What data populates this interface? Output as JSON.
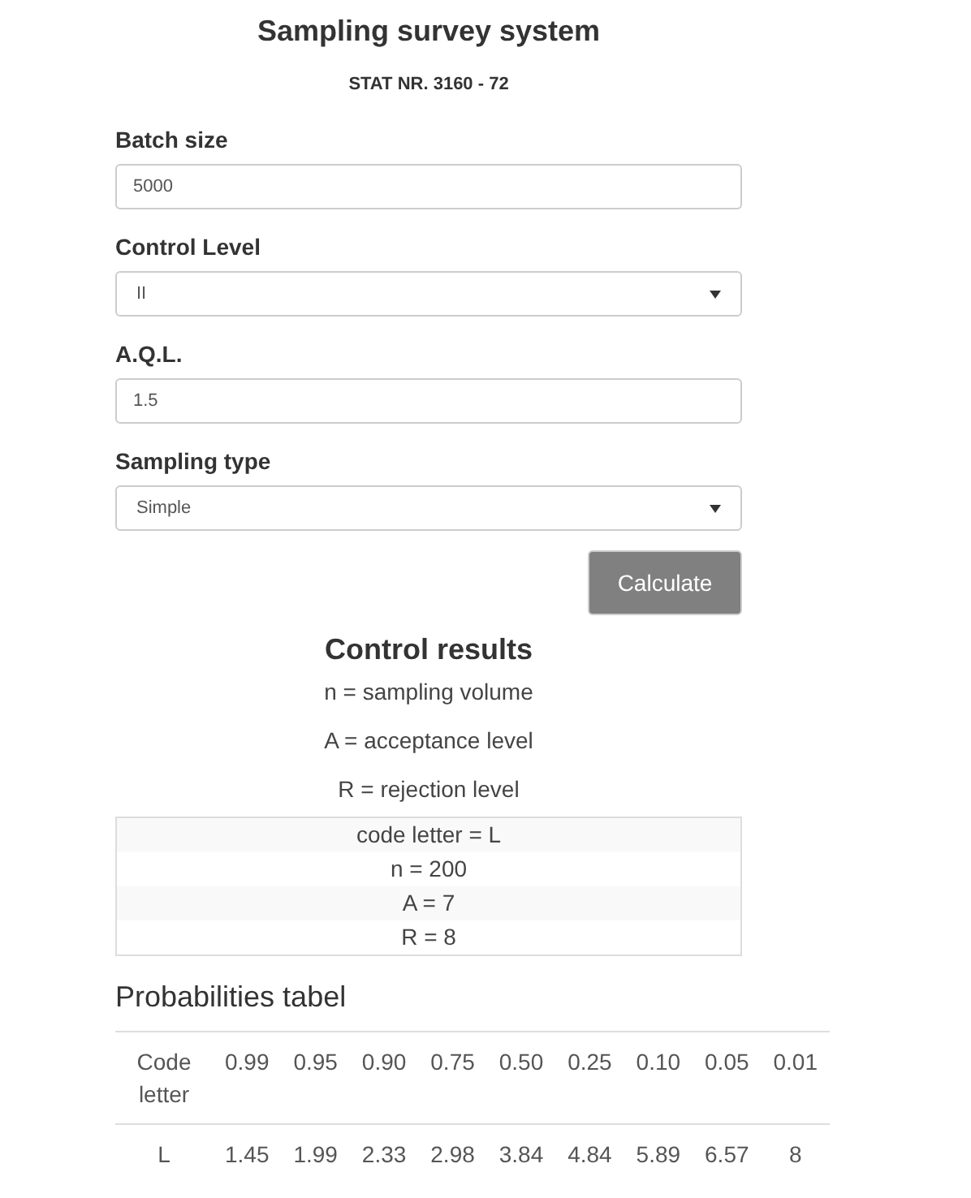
{
  "title": "Sampling survey system",
  "subtitle": "STAT NR. 3160 - 72",
  "fields": [
    {
      "label": "Batch size",
      "kind": "input",
      "value": "5000"
    },
    {
      "label": "Control Level",
      "kind": "select",
      "value": "II"
    },
    {
      "label": "A.Q.L.",
      "kind": "input",
      "value": "1.5"
    },
    {
      "label": "Sampling type",
      "kind": "select",
      "value": "Simple"
    }
  ],
  "calculate_button": "Calculate",
  "results": {
    "title": "Control results",
    "legend": [
      "n = sampling volume",
      "A = acceptance level",
      "R = rejection level"
    ],
    "rows": [
      "code letter = L",
      "n = 200",
      "A = 7",
      "R = 8"
    ]
  },
  "probabilities": {
    "title": "Probabilities tabel",
    "columns": [
      "Code letter",
      "0.99",
      "0.95",
      "0.90",
      "0.75",
      "0.50",
      "0.25",
      "0.10",
      "0.05",
      "0.01"
    ],
    "rows": [
      [
        "L",
        "1.45",
        "1.99",
        "2.33",
        "2.98",
        "3.84",
        "4.84",
        "5.89",
        "6.57",
        "8"
      ]
    ]
  }
}
